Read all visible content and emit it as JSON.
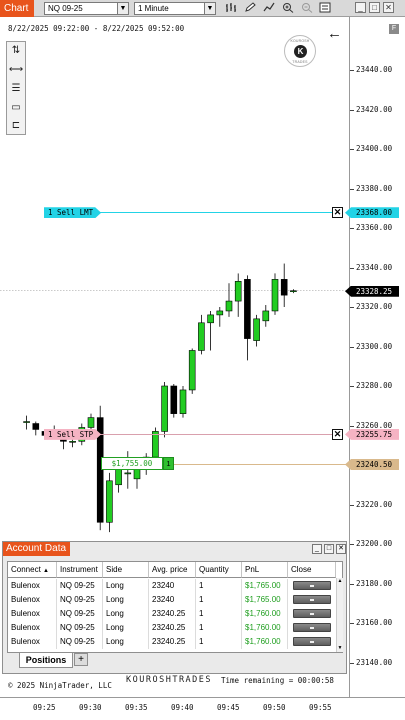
{
  "toolbar": {
    "chart_tab": "Chart",
    "instrument": "NQ 09-25",
    "interval": "1 Minute",
    "icons": [
      "bar-type-icon",
      "pencil-icon",
      "strategy-icon",
      "zoom-in-icon",
      "zoom-out-icon",
      "properties-icon"
    ],
    "window_buttons": [
      "minimize",
      "maximize",
      "close"
    ]
  },
  "chart": {
    "range_label": "8/22/2025 09:22:00 - 8/22/2025 09:52:00",
    "logo_top_text": "KOUROSH",
    "logo_letter": "K",
    "logo_bottom_text": "TRADES",
    "colors": {
      "up": "#22cc22",
      "down": "#000000",
      "accent": "#e8541c",
      "limit": "#22d3e6",
      "stop": "#f5b3c3",
      "last": "#000000",
      "avg": "#d9b98c"
    },
    "candles": [
      {
        "time": "09:23",
        "open": 23262,
        "high": 23265,
        "low": 23258,
        "close": 23262
      },
      {
        "time": "09:24",
        "open": 23261,
        "high": 23262,
        "low": 23255,
        "close": 23258
      },
      {
        "time": "09:25",
        "open": 23257,
        "high": 23258,
        "low": 23254,
        "close": 23255
      },
      {
        "time": "09:26",
        "open": 23255,
        "high": 23260,
        "low": 23254,
        "close": 23258
      },
      {
        "time": "09:27",
        "open": 23257,
        "high": 23258,
        "low": 23248,
        "close": 23252
      },
      {
        "time": "09:28",
        "open": 23252,
        "high": 23255,
        "low": 23249,
        "close": 23252
      },
      {
        "time": "09:29",
        "open": 23252,
        "high": 23261,
        "low": 23250,
        "close": 23259
      },
      {
        "time": "09:30",
        "open": 23259,
        "high": 23266,
        "low": 23256,
        "close": 23264
      },
      {
        "time": "09:31",
        "open": 23264,
        "high": 23270,
        "low": 23207,
        "close": 23211
      },
      {
        "time": "09:32",
        "open": 23211,
        "high": 23236,
        "low": 23206,
        "close": 23232
      },
      {
        "time": "09:33",
        "open": 23230,
        "high": 23243,
        "low": 23226,
        "close": 23239
      },
      {
        "time": "09:34",
        "open": 23236,
        "high": 23247,
        "low": 23228,
        "close": 23236
      },
      {
        "time": "09:35",
        "open": 23233,
        "high": 23242,
        "low": 23228,
        "close": 23238
      },
      {
        "time": "09:36",
        "open": 23238,
        "high": 23246,
        "low": 23235,
        "close": 23244
      },
      {
        "time": "09:37",
        "open": 23244,
        "high": 23259,
        "low": 23243,
        "close": 23257
      },
      {
        "time": "09:38",
        "open": 23257,
        "high": 23282,
        "low": 23254,
        "close": 23280
      },
      {
        "time": "09:39",
        "open": 23280,
        "high": 23281,
        "low": 23264,
        "close": 23266
      },
      {
        "time": "09:40",
        "open": 23266,
        "high": 23280,
        "low": 23264,
        "close": 23278
      },
      {
        "time": "09:41",
        "open": 23278,
        "high": 23299,
        "low": 23276,
        "close": 23298
      },
      {
        "time": "09:42",
        "open": 23298,
        "high": 23316,
        "low": 23296,
        "close": 23312
      },
      {
        "time": "09:43",
        "open": 23312,
        "high": 23318,
        "low": 23298,
        "close": 23316
      },
      {
        "time": "09:44",
        "open": 23316,
        "high": 23320,
        "low": 23310,
        "close": 23318
      },
      {
        "time": "09:45",
        "open": 23318,
        "high": 23332,
        "low": 23315,
        "close": 23323
      },
      {
        "time": "09:46",
        "open": 23323,
        "high": 23337,
        "low": 23315,
        "close": 23333
      },
      {
        "time": "09:47",
        "open": 23334,
        "high": 23336,
        "low": 23293,
        "close": 23304
      },
      {
        "time": "09:48",
        "open": 23303,
        "high": 23316,
        "low": 23300,
        "close": 23314
      },
      {
        "time": "09:49",
        "open": 23313,
        "high": 23321,
        "low": 23310,
        "close": 23318
      },
      {
        "time": "09:50",
        "open": 23318,
        "high": 23337,
        "low": 23316,
        "close": 23334
      },
      {
        "time": "09:51",
        "open": 23334,
        "high": 23342,
        "low": 23320,
        "close": 23326
      },
      {
        "time": "09:52",
        "open": 23328.25,
        "high": 23329,
        "low": 23327,
        "close": 23328.25
      }
    ],
    "y_ticks": [
      "23440.00",
      "23420.00",
      "23400.00",
      "23380.00",
      "23360.00",
      "23340.00",
      "23320.00",
      "23300.00",
      "23280.00",
      "23260.00",
      "23240.00",
      "23220.00",
      "23200.00",
      "23180.00",
      "23160.00",
      "23140.00"
    ],
    "x_ticks": [
      "09:25",
      "09:30",
      "09:35",
      "09:40",
      "09:45",
      "09:50",
      "09:55"
    ],
    "limit_order": {
      "label": "1 Sell LMT",
      "price_label": "23368.00",
      "price": 23368.0
    },
    "stop_order": {
      "label": "1 Sell STP",
      "price_label": "23255.75",
      "price": 23255.75
    },
    "last_price": {
      "label": "23328.25",
      "price": 23328.25
    },
    "position": {
      "pnl": "$1,755.00",
      "qty": "1",
      "avg_label": "23240.50",
      "avg": 23240.5
    }
  },
  "account": {
    "title": "Account Data",
    "columns": [
      "Connect",
      "Instrument",
      "Side",
      "Avg. price",
      "Quantity",
      "PnL",
      "Close"
    ],
    "rows": [
      [
        "Bulenox",
        "NQ 09-25",
        "Long",
        "23240",
        "1",
        "$1,765.00"
      ],
      [
        "Bulenox",
        "NQ 09-25",
        "Long",
        "23240",
        "1",
        "$1,765.00"
      ],
      [
        "Bulenox",
        "NQ 09-25",
        "Long",
        "23240.25",
        "1",
        "$1,760.00"
      ],
      [
        "Bulenox",
        "NQ 09-25",
        "Long",
        "23240.25",
        "1",
        "$1,760.00"
      ],
      [
        "Bulenox",
        "NQ 09-25",
        "Long",
        "23240.25",
        "1",
        "$1,760.00"
      ]
    ],
    "tab": "Positions",
    "add_tab": "+"
  },
  "footer": {
    "copyright": "© 2025 NinjaTrader, LLC",
    "brand": "KOUROSHTRADES",
    "time_remaining": "Time remaining = 00:00:58"
  }
}
